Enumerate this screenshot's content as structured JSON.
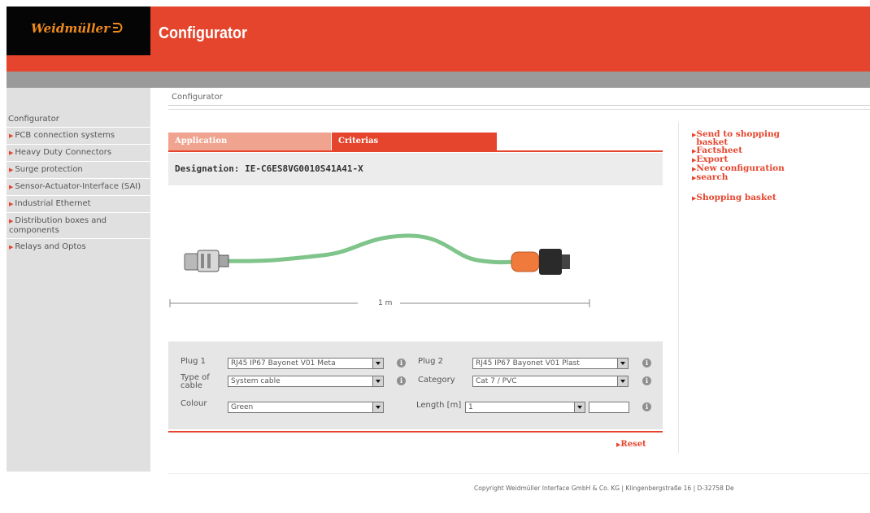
{
  "header": {
    "logo": "Weidmüller",
    "title": "Configurator"
  },
  "sidebar": {
    "heading": "Configurator",
    "items": [
      {
        "label": "PCB connection systems"
      },
      {
        "label": "Heavy Duty Connectors"
      },
      {
        "label": "Surge protection"
      },
      {
        "label": "Sensor-Actuator-Interface (SAI)"
      },
      {
        "label": "Industrial Ethernet"
      },
      {
        "label": "Distribution boxes and components"
      },
      {
        "label": "Relays and Optos"
      }
    ]
  },
  "breadcrumb": "Configurator",
  "tabs": {
    "application": "Application",
    "criterias": "Criterias"
  },
  "designation": "Designation: IE-C6ES8VG0010S41A41-X",
  "dimension_label": "1 m",
  "form": {
    "plug1": {
      "label": "Plug 1",
      "value": "RJ45 IP67 Bayonet V01 Meta"
    },
    "plug2": {
      "label": "Plug 2",
      "value": "RJ45 IP67 Bayonet V01 Plast"
    },
    "type_of_cable": {
      "label": "Type of cable",
      "value": "System cable"
    },
    "category": {
      "label": "Category",
      "value": "Cat 7 / PVC"
    },
    "colour": {
      "label": "Colour",
      "value": "Green"
    },
    "length": {
      "label": "Length [m]",
      "value": "1",
      "text_value": ""
    }
  },
  "reset_label": "Reset",
  "actions": {
    "send_to_basket": "Send to shopping basket",
    "factsheet": "Factsheet",
    "export": "Export",
    "new_configuration": "New configuration",
    "search": "search",
    "shopping_basket": "Shopping basket"
  },
  "footer": "Copyright Weidmüller Interface GmbH & Co. KG | Klingenbergstraße 16 | D-32758 De",
  "colors": {
    "brand_red": "#e5452d",
    "cable_green": "#7fc48a",
    "plug_orange": "#f07a3c"
  },
  "icons": {
    "info": "info-icon",
    "arrow": "arrow-right-icon",
    "dropdown": "chevron-down-icon"
  }
}
